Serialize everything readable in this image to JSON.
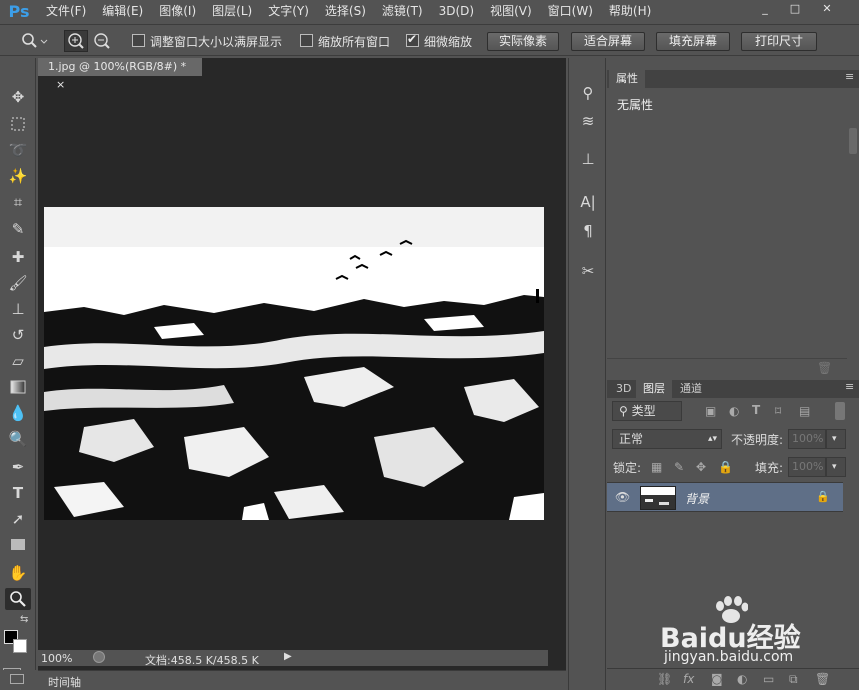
{
  "app": {
    "logo": "Ps"
  },
  "menu": [
    "文件(F)",
    "编辑(E)",
    "图像(I)",
    "图层(L)",
    "文字(Y)",
    "选择(S)",
    "滤镜(T)",
    "3D(D)",
    "视图(V)",
    "窗口(W)",
    "帮助(H)"
  ],
  "window_controls": {
    "minimize": "_",
    "maximize": "□",
    "close": "✕"
  },
  "options": {
    "resize_windows": "调整窗口大小以满屏显示",
    "zoom_all": "缩放所有窗口",
    "scrubby_zoom": "细微缩放",
    "actual_pixels": "实际像素",
    "fit_screen": "适合屏幕",
    "fill_screen": "填充屏幕",
    "print_size": "打印尺寸",
    "resize_checked": false,
    "zoom_all_checked": false,
    "scrubby_checked": true
  },
  "document": {
    "tab_title": "1.jpg @ 100%(RGB/8#) *",
    "close": "×",
    "zoom": "100%",
    "doc_size": "文档:458.5 K/458.5 K"
  },
  "timeline": {
    "label": "时间轴"
  },
  "properties": {
    "tab": "属性",
    "content": "无属性"
  },
  "layers_panel": {
    "tabs": [
      "3D",
      "图层",
      "通道"
    ],
    "filter_kind": "类型",
    "blend_mode": "正常",
    "opacity_label": "不透明度:",
    "opacity_value": "100%",
    "lock_label": "锁定:",
    "fill_label": "填充:",
    "fill_value": "100%",
    "layers": [
      {
        "name": "背景",
        "visible": true,
        "locked": true
      }
    ]
  },
  "watermark": {
    "brand": "Baidu经验",
    "url": "jingyan.baidu.com"
  }
}
